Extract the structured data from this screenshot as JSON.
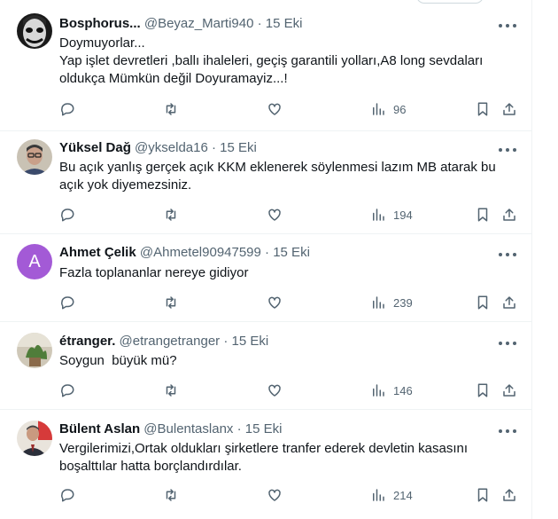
{
  "tweets": [
    {
      "name": "Bosphorus...",
      "handle": "@Beyaz_Marti940",
      "date": "· 15 Eki",
      "avatar": "joker-face-photo",
      "lines": [
        "Doymuyorlar...",
        "Yap işlet devretleri ,ballı ihaleleri, geçiş garantili yolları,A8 long sevdaları",
        "oldukça Mümkün değil Doyuramayiz...!"
      ],
      "views": "96"
    },
    {
      "name": "Yüksel Dağ",
      "handle": "@ykselda16",
      "date": "· 15 Eki",
      "avatar": "man-with-glasses-photo",
      "lines": [
        "Bu açık yanlış gerçek açık KKM eklenerek söylenmesi lazım MB atarak bu",
        "açık yok diyemezsiniz."
      ],
      "views": "194"
    },
    {
      "name": "Ahmet Çelik",
      "handle": "@Ahmetel90947599",
      "date": "· 15 Eki",
      "avatar_letter": "A",
      "avatar_color": "#a35ad6",
      "lines": [
        "Fazla toplananlar nereye gidiyor"
      ],
      "views": "239"
    },
    {
      "name": "étranger.",
      "handle": "@etrangetranger",
      "date": "· 15 Eki",
      "avatar": "plant-in-pot-photo",
      "lines": [
        "Soygun  büyük mü?"
      ],
      "views": "146"
    },
    {
      "name": "Bülent Aslan",
      "handle": "@Bulentaslanx",
      "date": "· 15 Eki",
      "avatar": "man-in-suit-with-flag-photo",
      "lines": [
        "Vergilerimizi,Ortak oldukları şirketlere tranfer ederek devletin kasasını",
        "boşalttılar hatta borçlandırdılar."
      ],
      "views": "214"
    }
  ],
  "icons": {
    "reply": "reply-icon",
    "retweet": "retweet-icon",
    "like": "heart-icon",
    "views": "views-chart-icon",
    "bookmark": "bookmark-icon",
    "share": "share-icon",
    "more": "more-options-icon"
  },
  "colors": {
    "text": "#0f1419",
    "secondary": "#536471",
    "divider": "#eff3f4",
    "avatar_letter_bg": "#a35ad6"
  }
}
